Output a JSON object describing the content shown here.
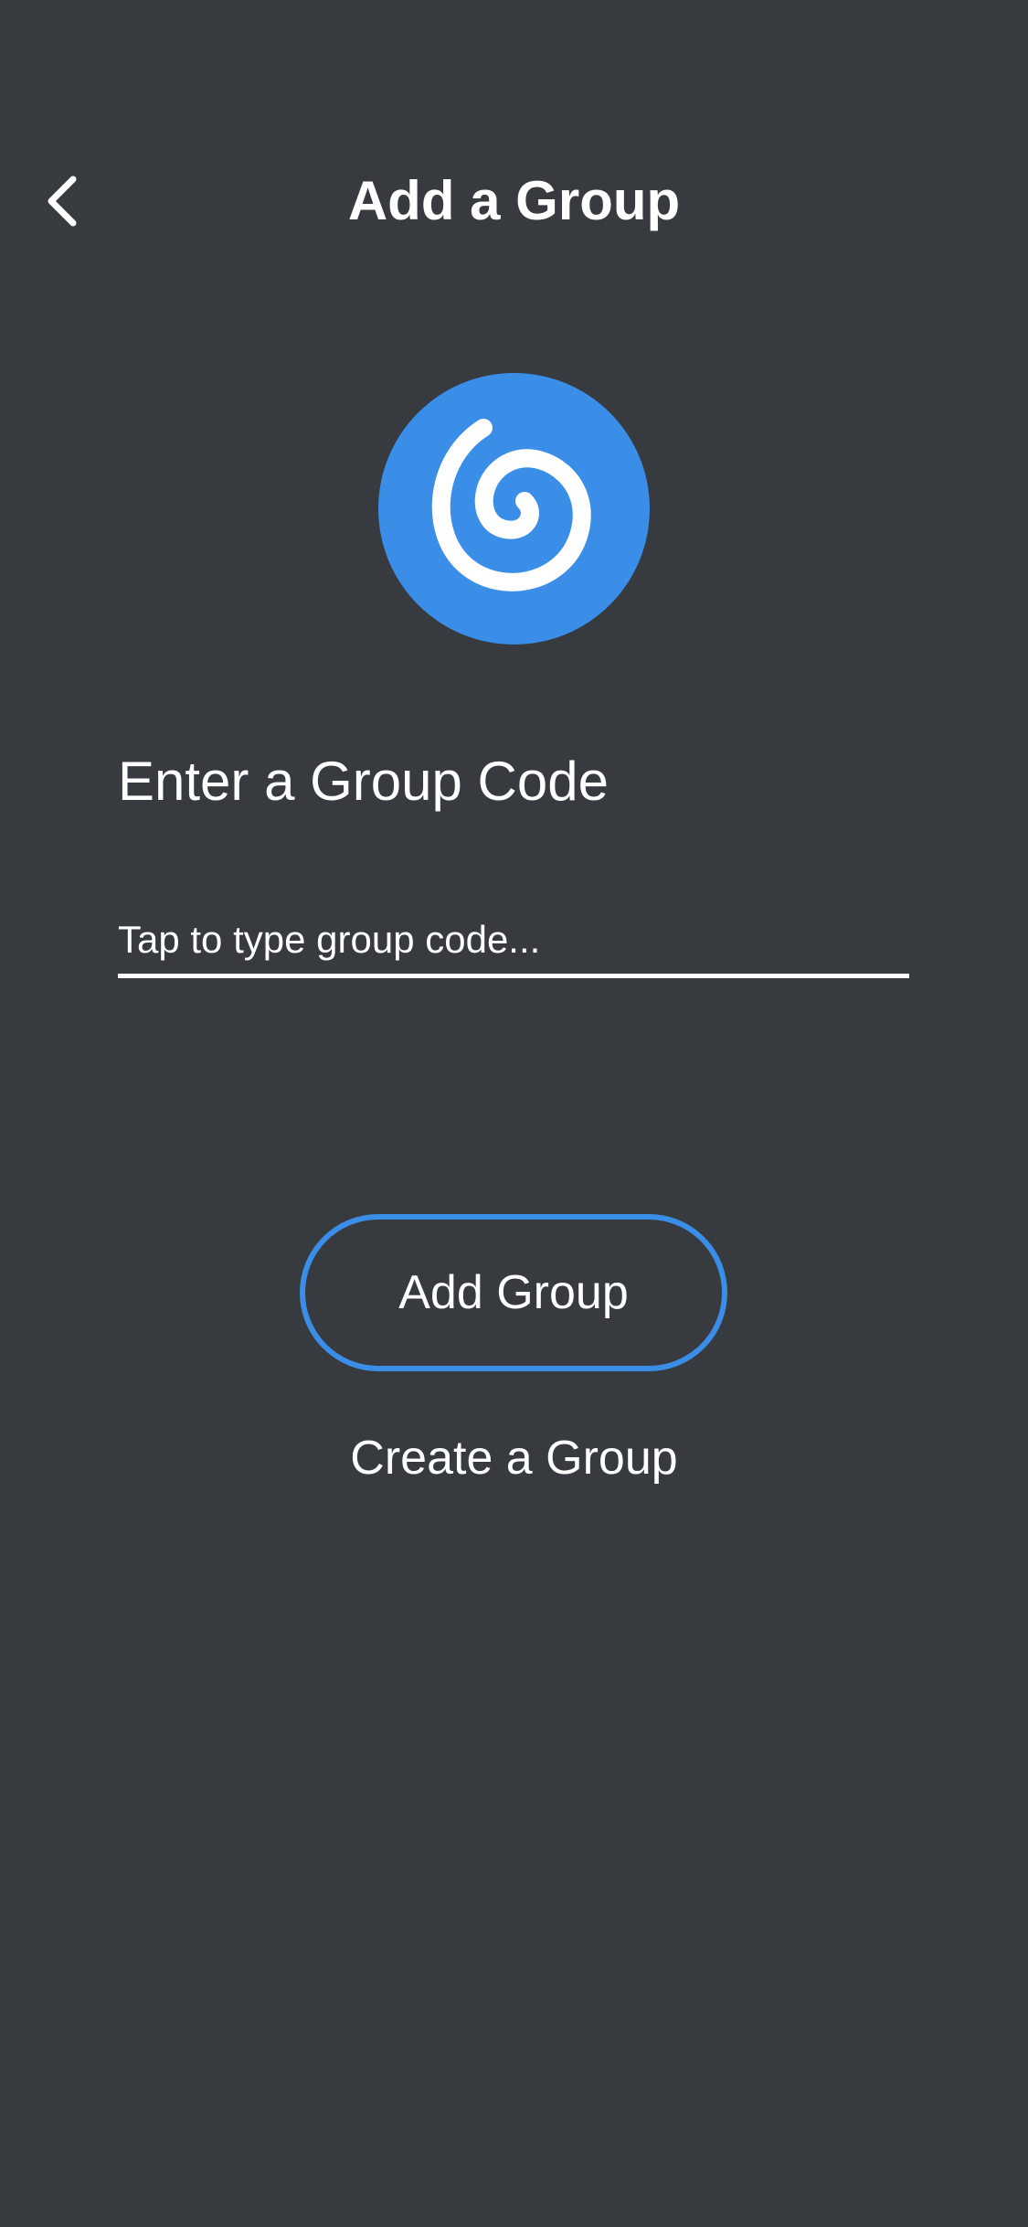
{
  "header": {
    "title": "Add a Group",
    "back_icon": "chevron-left-icon"
  },
  "logo": {
    "icon": "spiral-icon",
    "color": "#3a8ee8"
  },
  "form": {
    "heading": "Enter a Group Code",
    "code_placeholder": "Tap to type group code...",
    "code_value": ""
  },
  "actions": {
    "add_label": "Add Group",
    "create_label": "Create a Group"
  },
  "colors": {
    "background": "#373a3e",
    "accent": "#3a8ee8",
    "text": "#ffffff"
  }
}
